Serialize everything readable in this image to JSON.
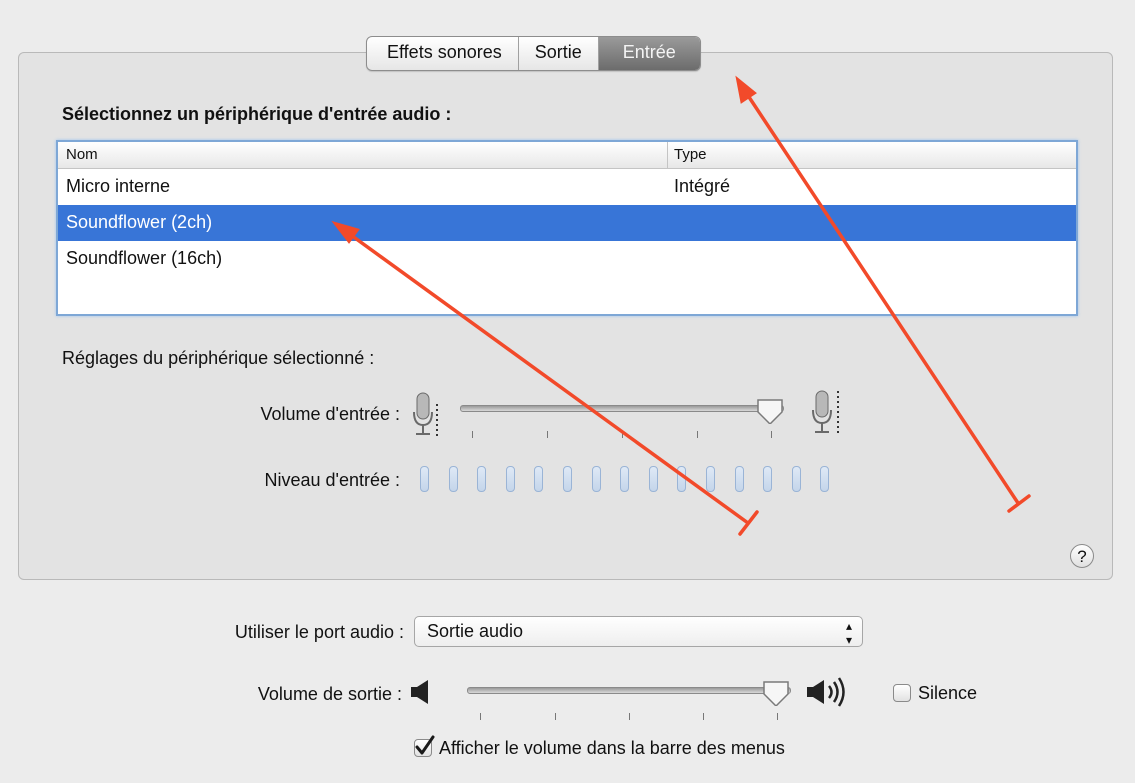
{
  "tabs": [
    {
      "label": "Effets sonores",
      "active": false
    },
    {
      "label": "Sortie",
      "active": false
    },
    {
      "label": "Entrée",
      "active": true
    }
  ],
  "input_section": {
    "title": "Sélectionnez un périphérique d'entrée audio :",
    "columns": [
      "Nom",
      "Type"
    ],
    "devices": [
      {
        "name": "Micro interne",
        "type": "Intégré",
        "selected": false
      },
      {
        "name": "Soundflower (2ch)",
        "type": "",
        "selected": true
      },
      {
        "name": "Soundflower (16ch)",
        "type": "",
        "selected": false
      }
    ]
  },
  "device_settings": {
    "title": "Réglages du périphérique sélectionné :",
    "input_volume_label": "Volume d'entrée :",
    "input_volume_level": 0.97,
    "input_level_label": "Niveau d'entrée :",
    "input_level_bars": 15,
    "input_level_active": 0
  },
  "help_label": "?",
  "output": {
    "port_label": "Utiliser le port audio :",
    "port_value": "Sortie audio",
    "port_arrows": "⌃⌄",
    "volume_label": "Volume de sortie :",
    "volume_level": 0.97,
    "mute_label": "Silence",
    "mute_checked": false,
    "show_menu_label": "Afficher le volume dans la barre des menus",
    "show_menu_checked": true
  },
  "colors": {
    "selection": "#3875d7",
    "annotation_arrow": "#f24a2a",
    "focus_ring": "#7ea7d6"
  },
  "icons": [
    "microphone-low-icon",
    "microphone-high-icon",
    "speaker-low-icon",
    "speaker-high-icon",
    "checkmark-icon",
    "help-icon"
  ]
}
